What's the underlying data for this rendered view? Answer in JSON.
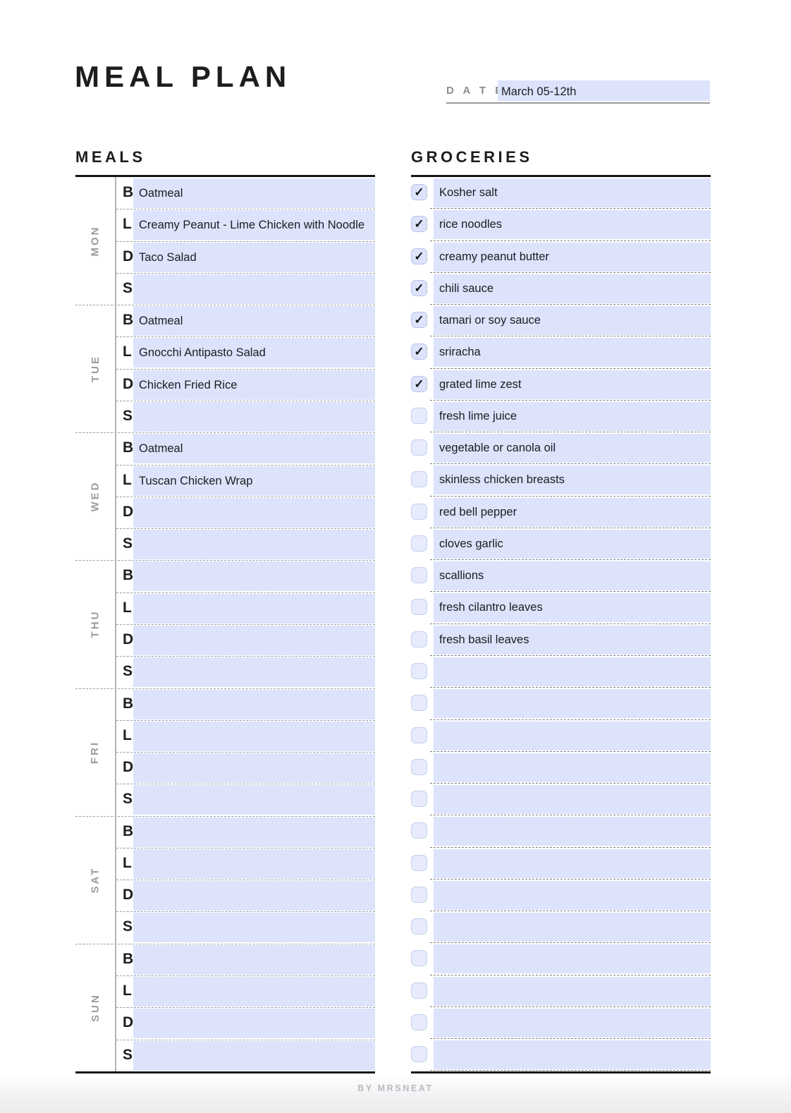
{
  "document": {
    "title": "MEAL PLAN",
    "footer": "BY MRSNEAT"
  },
  "date": {
    "label": "D A T E :",
    "value": "March 05-12th",
    "placeholder": ""
  },
  "meals": {
    "heading": "MEALS",
    "slot_letters": [
      "B",
      "L",
      "D",
      "S"
    ],
    "days": [
      {
        "day": "MON",
        "entries": [
          {
            "slot": "B",
            "value": "Oatmeal"
          },
          {
            "slot": "L",
            "value": "Creamy Peanut - Lime Chicken with Noodle"
          },
          {
            "slot": "D",
            "value": "Taco Salad"
          },
          {
            "slot": "S",
            "value": ""
          }
        ]
      },
      {
        "day": "TUE",
        "entries": [
          {
            "slot": "B",
            "value": "Oatmeal"
          },
          {
            "slot": "L",
            "value": "Gnocchi Antipasto Salad"
          },
          {
            "slot": "D",
            "value": "Chicken Fried Rice"
          },
          {
            "slot": "S",
            "value": ""
          }
        ]
      },
      {
        "day": "WED",
        "entries": [
          {
            "slot": "B",
            "value": "Oatmeal"
          },
          {
            "slot": "L",
            "value": "Tuscan Chicken Wrap"
          },
          {
            "slot": "D",
            "value": ""
          },
          {
            "slot": "S",
            "value": ""
          }
        ]
      },
      {
        "day": "THU",
        "entries": [
          {
            "slot": "B",
            "value": ""
          },
          {
            "slot": "L",
            "value": ""
          },
          {
            "slot": "D",
            "value": ""
          },
          {
            "slot": "S",
            "value": ""
          }
        ]
      },
      {
        "day": "FRI",
        "entries": [
          {
            "slot": "B",
            "value": ""
          },
          {
            "slot": "L",
            "value": ""
          },
          {
            "slot": "D",
            "value": ""
          },
          {
            "slot": "S",
            "value": ""
          }
        ]
      },
      {
        "day": "SAT",
        "entries": [
          {
            "slot": "B",
            "value": ""
          },
          {
            "slot": "L",
            "value": ""
          },
          {
            "slot": "D",
            "value": ""
          },
          {
            "slot": "S",
            "value": ""
          }
        ]
      },
      {
        "day": "SUN",
        "entries": [
          {
            "slot": "B",
            "value": ""
          },
          {
            "slot": "L",
            "value": ""
          },
          {
            "slot": "D",
            "value": ""
          },
          {
            "slot": "S",
            "value": ""
          }
        ]
      }
    ]
  },
  "groceries": {
    "heading": "GROCERIES",
    "check_glyph": "✓",
    "items": [
      {
        "checked": true,
        "value": "Kosher salt"
      },
      {
        "checked": true,
        "value": "rice noodles"
      },
      {
        "checked": true,
        "value": "creamy peanut butter"
      },
      {
        "checked": true,
        "value": "chili sauce"
      },
      {
        "checked": true,
        "value": "tamari or soy sauce"
      },
      {
        "checked": true,
        "value": "sriracha"
      },
      {
        "checked": true,
        "value": "grated lime zest"
      },
      {
        "checked": false,
        "value": "fresh lime juice"
      },
      {
        "checked": false,
        "value": "vegetable or canola oil"
      },
      {
        "checked": false,
        "value": "skinless chicken breasts"
      },
      {
        "checked": false,
        "value": "red bell pepper"
      },
      {
        "checked": false,
        "value": "cloves garlic"
      },
      {
        "checked": false,
        "value": "scallions"
      },
      {
        "checked": false,
        "value": "fresh cilantro leaves"
      },
      {
        "checked": false,
        "value": "fresh basil leaves"
      },
      {
        "checked": false,
        "value": ""
      },
      {
        "checked": false,
        "value": ""
      },
      {
        "checked": false,
        "value": ""
      },
      {
        "checked": false,
        "value": ""
      },
      {
        "checked": false,
        "value": ""
      },
      {
        "checked": false,
        "value": ""
      },
      {
        "checked": false,
        "value": ""
      },
      {
        "checked": false,
        "value": ""
      },
      {
        "checked": false,
        "value": ""
      },
      {
        "checked": false,
        "value": ""
      },
      {
        "checked": false,
        "value": ""
      },
      {
        "checked": false,
        "value": ""
      },
      {
        "checked": false,
        "value": ""
      }
    ]
  },
  "colors": {
    "field_fill": "#dce3fb",
    "rule": "#16161a",
    "muted": "#9b9b9f"
  }
}
